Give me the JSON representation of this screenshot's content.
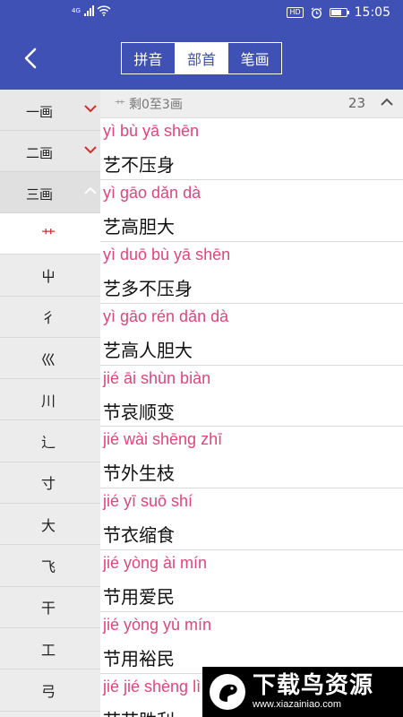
{
  "status_bar": {
    "network": "4G",
    "hd": "HD",
    "battery_level": 0.7,
    "time": "15:05"
  },
  "app_bar": {
    "tabs": [
      {
        "label": "拼音",
        "active": false
      },
      {
        "label": "部首",
        "active": true
      },
      {
        "label": "笔画",
        "active": false
      }
    ]
  },
  "sidebar": {
    "groups": [
      {
        "label": "一画",
        "state": "collapsed"
      },
      {
        "label": "二画",
        "state": "collapsed"
      },
      {
        "label": "三画",
        "state": "expanded"
      }
    ],
    "radicals": [
      "艹",
      "屮",
      "彳",
      "巛",
      "川",
      "辶",
      "寸",
      "大",
      "飞",
      "干",
      "工",
      "弓"
    ],
    "selected_radical": "艹"
  },
  "content": {
    "header": {
      "radical": "艹",
      "label": "剩0至3画",
      "count": "23"
    },
    "entries": [
      {
        "pinyin": "yì bù yā shēn",
        "text": "艺不压身"
      },
      {
        "pinyin": "yì gāo dǎn dà",
        "text": "艺高胆大"
      },
      {
        "pinyin": "yì duō bù yā shēn",
        "text": "艺多不压身"
      },
      {
        "pinyin": "yì gāo rén dǎn dà",
        "text": "艺高人胆大"
      },
      {
        "pinyin": "jié āi shùn biàn",
        "text": "节哀顺变"
      },
      {
        "pinyin": "jié wài shēng zhī",
        "text": "节外生枝"
      },
      {
        "pinyin": "jié yī suō shí",
        "text": "节衣缩食"
      },
      {
        "pinyin": "jié yòng ài mín",
        "text": "节用爱民"
      },
      {
        "pinyin": "jié yòng yù mín",
        "text": "节用裕民"
      },
      {
        "pinyin": "jié jié shèng lì",
        "text": "节节胜利"
      }
    ]
  },
  "watermark": {
    "title": "下载鸟资源",
    "url": "www.xiazainiao.com"
  },
  "colors": {
    "primary": "#3f51b5",
    "pinyin": "#e0457b",
    "accent_red": "#d32f2f"
  }
}
